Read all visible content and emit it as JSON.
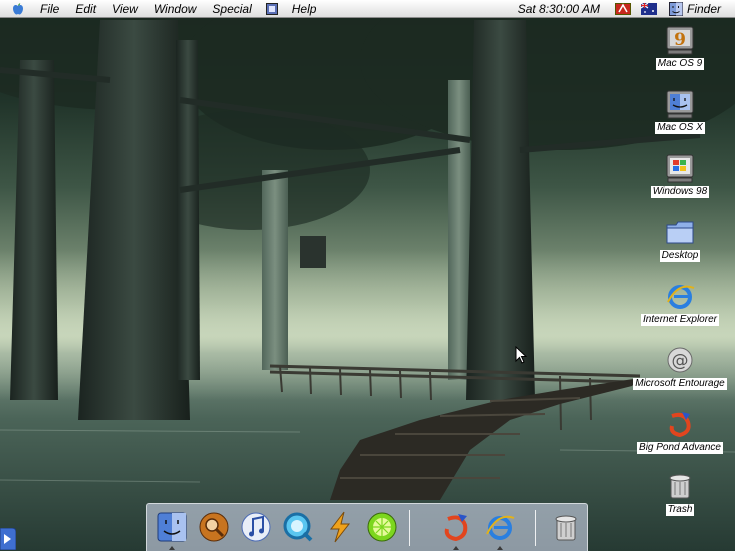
{
  "menubar": {
    "items": [
      "File",
      "Edit",
      "View",
      "Window",
      "Special",
      "Help"
    ],
    "clock": "Sat 8:30:00 AM",
    "app": "Finder"
  },
  "desktop_icons": [
    {
      "label": "Mac OS 9",
      "icon": "mac-os-9-icon"
    },
    {
      "label": "Mac OS X",
      "icon": "mac-os-x-icon"
    },
    {
      "label": "Windows 98",
      "icon": "windows-98-icon"
    },
    {
      "label": "Desktop",
      "icon": "folder-icon"
    },
    {
      "label": "Internet Explorer",
      "icon": "internet-explorer-icon"
    },
    {
      "label": "Microsoft Entourage",
      "icon": "microsoft-entourage-icon"
    },
    {
      "label": "Big Pond Advance",
      "icon": "big-pond-advance-icon"
    },
    {
      "label": "Trash",
      "icon": "trash-icon"
    }
  ],
  "dock": {
    "items": [
      {
        "icon": "finder-face-icon",
        "running": true
      },
      {
        "icon": "sherlock-icon",
        "running": false
      },
      {
        "icon": "itunes-icon",
        "running": false
      },
      {
        "icon": "quicktime-icon",
        "running": false
      },
      {
        "icon": "lightning-app-icon",
        "running": false
      },
      {
        "icon": "lime-app-icon",
        "running": false
      },
      {
        "icon": "big-pond-dock-icon",
        "running": true
      },
      {
        "icon": "internet-explorer-dock-icon",
        "running": true
      },
      {
        "icon": "trash-dock-icon",
        "running": false
      }
    ]
  },
  "colors": {
    "menubar": "#e6e6e6",
    "dock": "#dfe6ff",
    "water": "#8aa092",
    "sky": "#c3d2b5"
  }
}
